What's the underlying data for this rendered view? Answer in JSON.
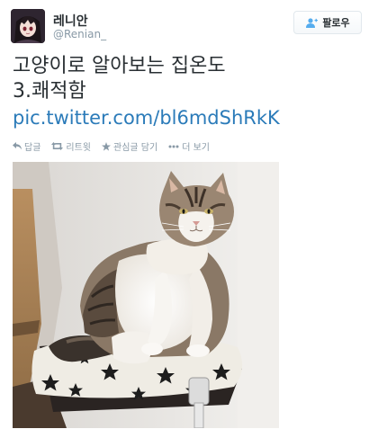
{
  "user": {
    "display_name": "레니안",
    "handle": "@Renian_",
    "avatar_icon": "anime-avatar-icon"
  },
  "follow_button": {
    "label": "팔로우",
    "icon": "add-user-icon",
    "accent": "#55acee"
  },
  "tweet": {
    "line1": "고양이로 알아보는 집온도",
    "line2": "3.쾌적함",
    "link": "pic.twitter.com/bl6mdShRkK",
    "link_color": "#2b7bb9"
  },
  "actions": [
    {
      "label": "답글",
      "icon": "reply-icon"
    },
    {
      "label": "리트윗",
      "icon": "retweet-icon"
    },
    {
      "label": "관심글 담기",
      "icon": "star-icon"
    },
    {
      "label": "더 보기",
      "icon": "more-icon"
    }
  ],
  "media": {
    "icon": "cat-photo"
  }
}
